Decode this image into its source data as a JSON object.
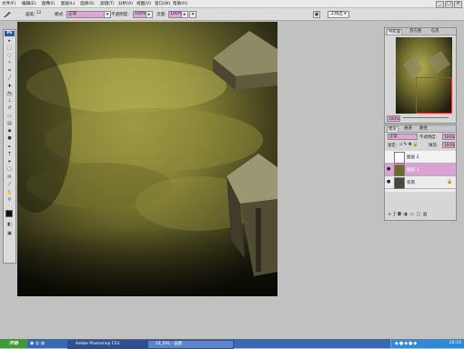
{
  "menubar": {
    "items": [
      "文件(F)",
      "编辑(E)",
      "图像(I)",
      "图层(L)",
      "选择(S)",
      "滤镜(T)",
      "分析(A)",
      "视图(V)",
      "窗口(W)",
      "帮助(H)"
    ],
    "window_buttons": [
      "_",
      "□",
      "×"
    ]
  },
  "options_bar": {
    "brush_label": "画笔:",
    "brush_size": "13",
    "mode_label": "模式:",
    "mode_value": "正常",
    "opacity_label": "不透明度:",
    "opacity_value": "100%",
    "flow_label": "流量:",
    "flow_value": "100%",
    "workspace_label": "工作区 ▾"
  },
  "toolbox": {
    "logo": "Ps",
    "tools": [
      "move",
      "marquee",
      "lasso",
      "magic-wand",
      "crop",
      "slice",
      "healing",
      "brush",
      "stamp",
      "history-brush",
      "eraser",
      "gradient",
      "blur",
      "dodge",
      "pen",
      "type",
      "path-select",
      "shape",
      "notes",
      "eyedropper",
      "hand",
      "zoom"
    ]
  },
  "navigator_panel": {
    "tabs": [
      "导航器",
      "直方图",
      "信息"
    ],
    "zoom": "100%"
  },
  "layers_panel": {
    "tabs": [
      "图层",
      "通道",
      "路径"
    ],
    "blend_mode": "正常",
    "opacity_label": "不透明度:",
    "opacity_value": "100%",
    "lock_label": "锁定:",
    "fill_label": "填充:",
    "fill_value": "100%",
    "layers": [
      {
        "name": "图层 2",
        "selected": false
      },
      {
        "name": "图层 1",
        "selected": true
      },
      {
        "name": "背景",
        "selected": false
      }
    ]
  },
  "taskbar": {
    "start_label": "开始",
    "items": [
      "Adobe Photoshop CS3",
      "24_001 - 画图"
    ],
    "clock": "20:16"
  },
  "colors": {
    "accent": "#dfa7d6",
    "canvas_dark": "#2b2b16",
    "canvas_mid": "#6f6c2c",
    "canvas_light": "#b6b052",
    "taskbar": "#3a67b5"
  }
}
